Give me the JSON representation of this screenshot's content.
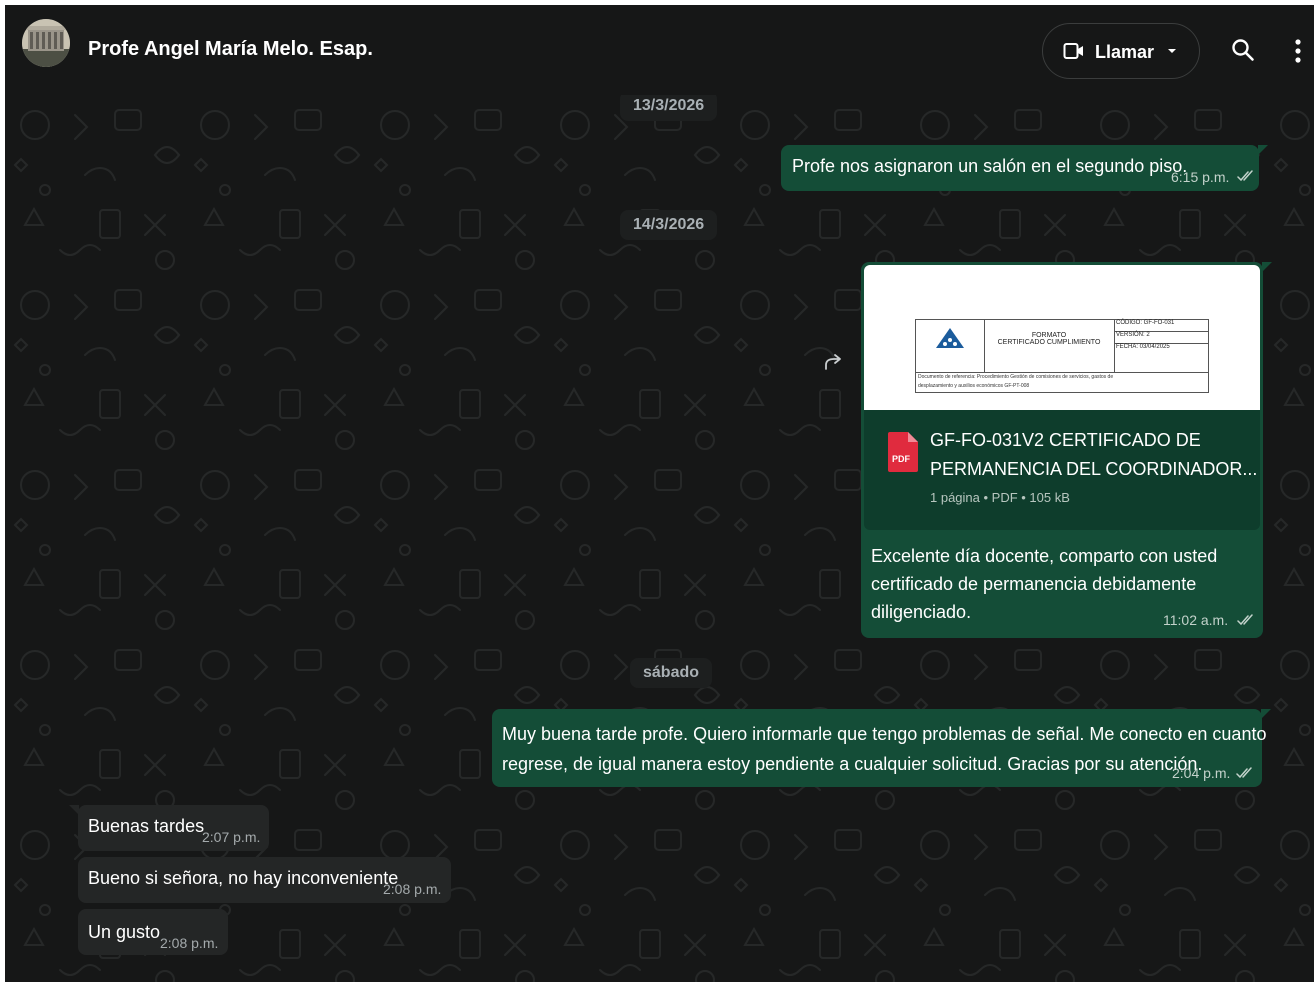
{
  "header": {
    "contact_name": "Profe Angel María Melo. Esap.",
    "call_label": "Llamar",
    "icons": [
      "video-call-icon",
      "chevron-down-icon",
      "search-icon",
      "more-vertical-icon"
    ]
  },
  "colors": {
    "background": "#161717",
    "outgoing_bubble": "#144d37",
    "incoming_bubble": "#242626",
    "pdf_red": "#e02b3e"
  },
  "dates": {
    "d1": "13/3/2026",
    "d2": "14/3/2026",
    "d3": "sábado"
  },
  "messages": {
    "m1": {
      "text": "Profe nos asignaron un salón en el segundo piso.",
      "time": "6:15 p.m."
    },
    "m2": {
      "doc_title_line1": "GF-FO-031V2 CERTIFICADO DE",
      "doc_title_line2": "PERMANENCIA DEL COORDINADOR...",
      "doc_meta": "1 página • PDF • 105 kB",
      "pdf_badge": "PDF",
      "caption_line1": "Excelente día docente, comparto con usted",
      "caption_line2": "certificado de permanencia debidamente",
      "caption_line3": "diligenciado.",
      "time": "11:02 a.m."
    },
    "m3": {
      "line1": "Muy buena tarde profe. Quiero informarle que tengo problemas de señal. Me conecto en cuanto",
      "line2": "regrese, de igual manera estoy pendiente a cualquier solicitud. Gracias por su atención.",
      "time": "2:04 p.m."
    },
    "m4": {
      "text": "Buenas tardes",
      "time": "2:07 p.m."
    },
    "m5": {
      "text": "Bueno si señora, no hay inconveniente",
      "time": "2:08 p.m."
    },
    "m6": {
      "text": "Un gusto",
      "time": "2:08 p.m."
    }
  },
  "doc_preview": {
    "doc_title_a": "FORMATO",
    "doc_title_b": "CERTIFICADO CUMPLIMIENTO",
    "codigo": "CÓDIGO: GF-FO-031",
    "version": "VERSIÓN: 2",
    "fecha": "FECHA: 03/04/2025",
    "referencia_1": "Documento de referencia: Procedimiento Gestión de comisiones de servicios, gastos de",
    "referencia_2": "desplazamiento y auxilios económicos GF-PT-008"
  }
}
